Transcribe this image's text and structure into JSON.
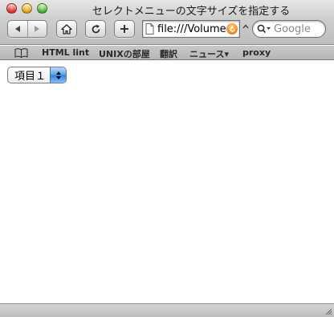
{
  "window": {
    "title": "セレクトメニューの文字サイズを指定する"
  },
  "toolbar": {
    "back_icon": "back-arrow-icon",
    "forward_icon": "forward-arrow-icon",
    "home_icon": "home-icon",
    "reload_icon": "reload-icon",
    "add_icon": "add-bookmark-icon",
    "url": "file:///Volume",
    "search_placeholder": "Google"
  },
  "bookmarks": {
    "items": [
      {
        "label": "HTML lint"
      },
      {
        "label": "UNIXの部屋"
      },
      {
        "label": "翻訳"
      },
      {
        "label": "ニュース▾"
      },
      {
        "label": "proxy"
      }
    ]
  },
  "content": {
    "select_value": "項目１"
  },
  "colors": {
    "select_accent": "#4a8ff0",
    "go_button": "#f28a1c"
  }
}
